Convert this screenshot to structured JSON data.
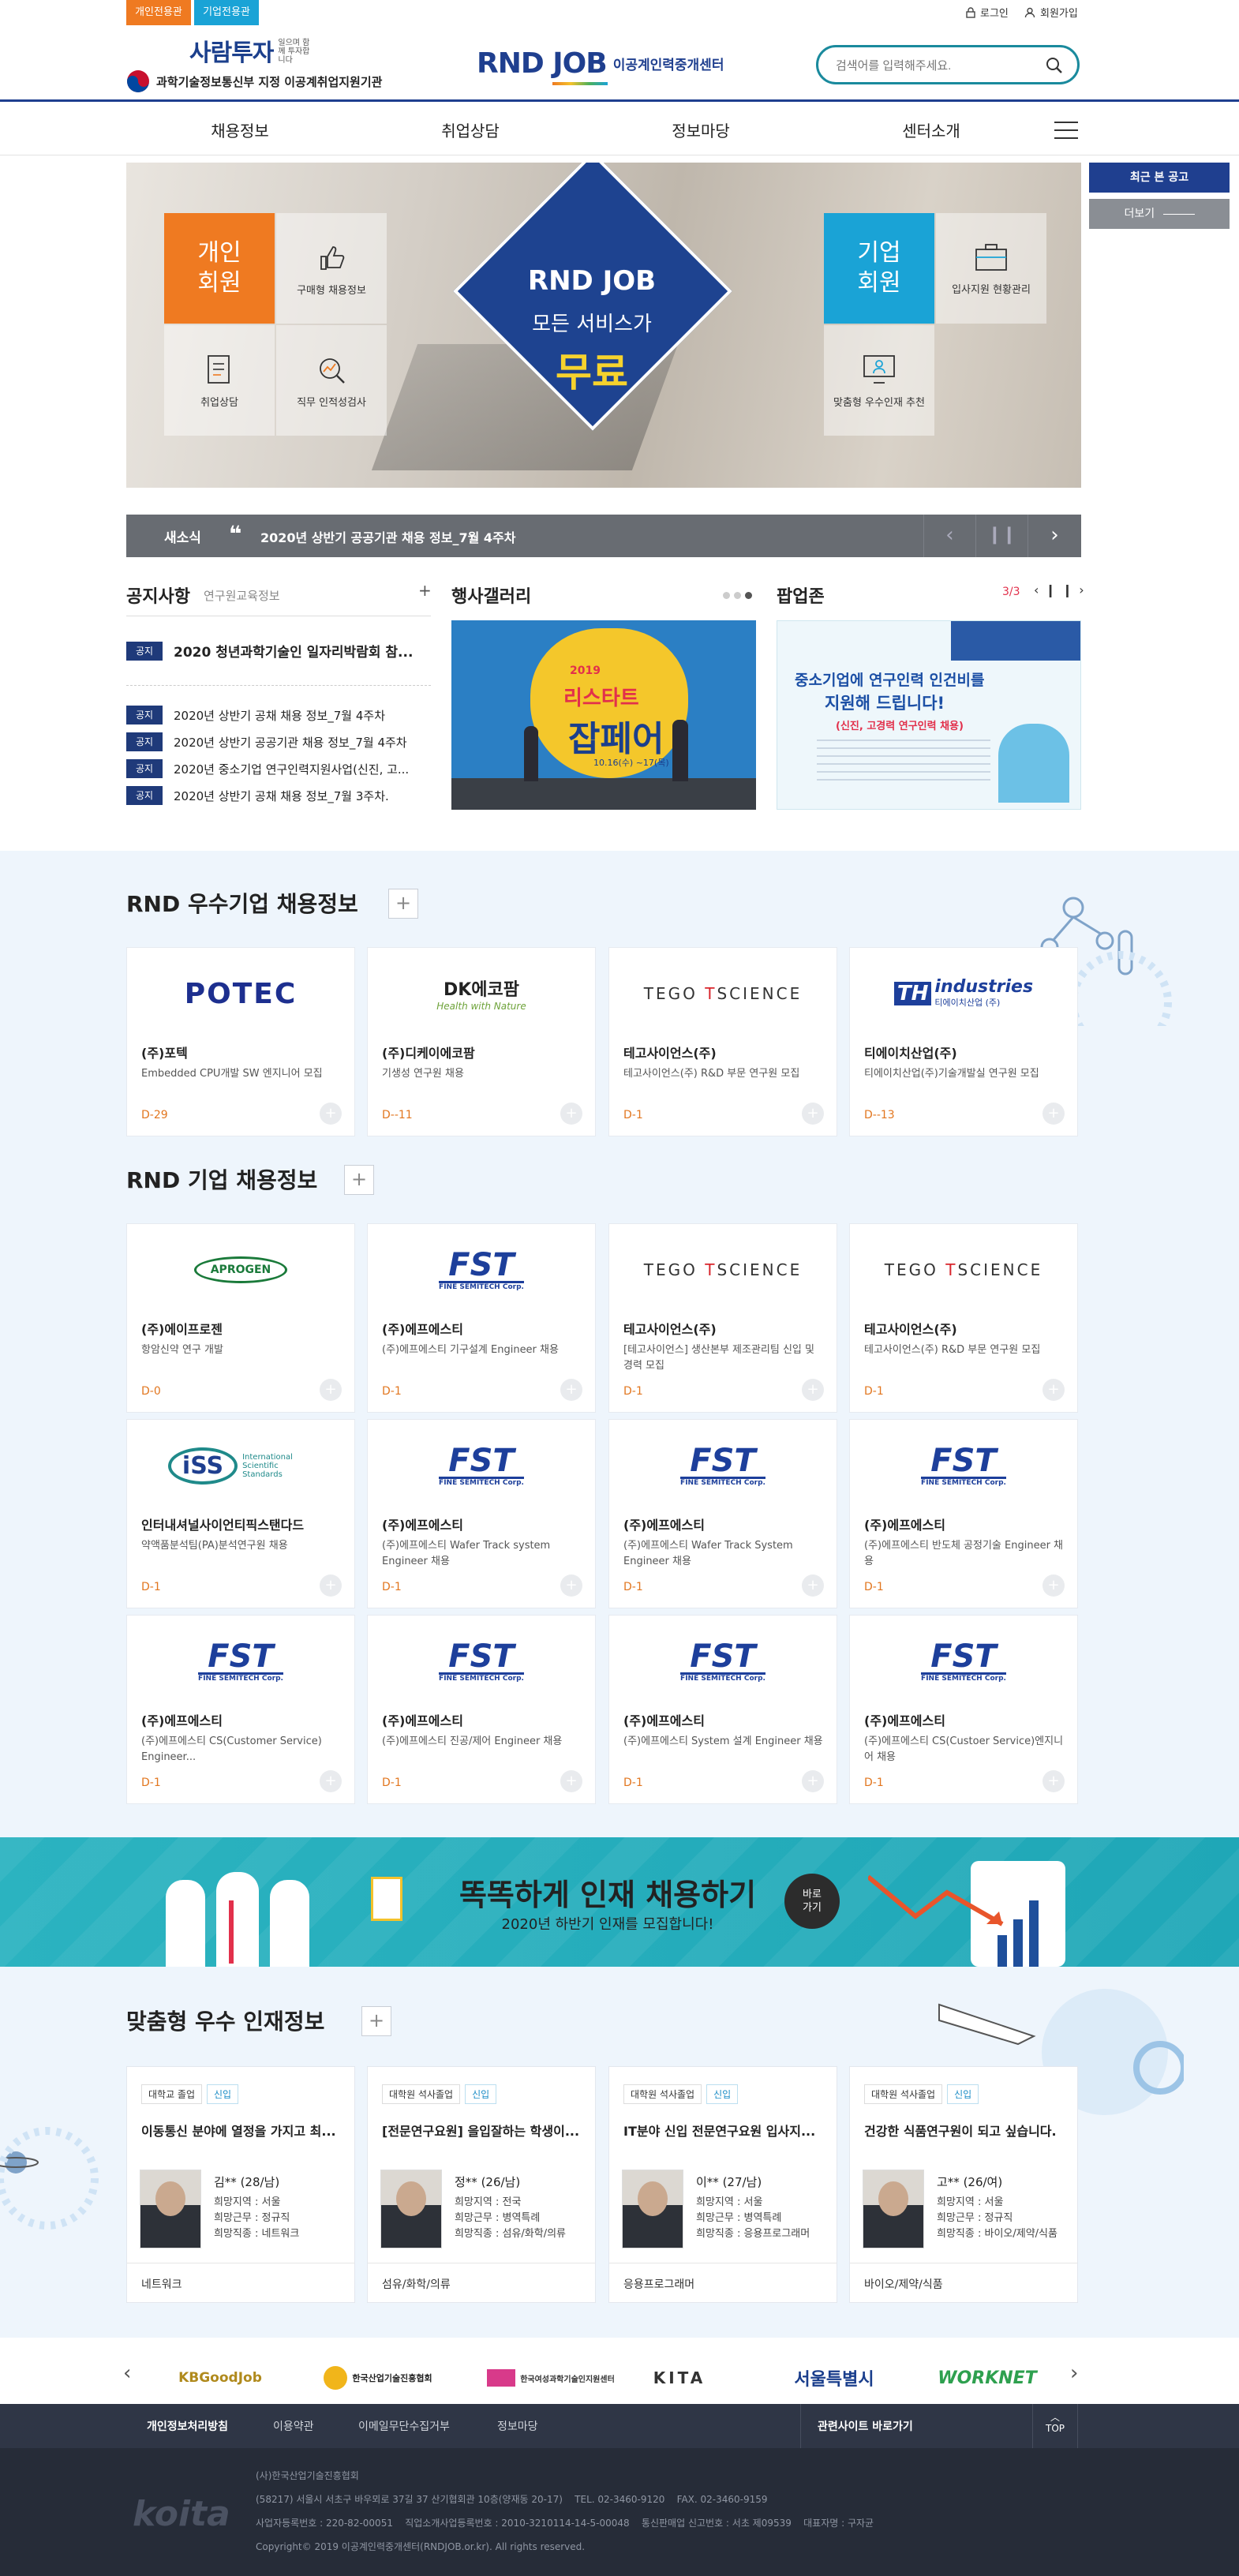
{
  "top": {
    "tabs": [
      "개인전용관",
      "기업전용관"
    ],
    "utils": {
      "login": "로그인",
      "join": "회원가입"
    },
    "brand_saramtuja": "사람투자",
    "brand_saramtuja_sub": "일으며 함께 투자합니다",
    "ministry": "과학기술정보통신부 지정 이공계취업지원기관",
    "logo_main": "RND JOB",
    "logo_sub": "이공계인력중개센터",
    "search_placeholder": "검색어를 입력해주세요."
  },
  "nav": [
    "채용정보",
    "취업상담",
    "정보마당",
    "센터소개"
  ],
  "side": {
    "recent": "최근 본 공고",
    "more": "더보기"
  },
  "hero": {
    "personal": "개인\n회원",
    "personal_items": [
      "구매형 채용정보",
      "취업상담",
      "직무 인적성검사"
    ],
    "center_logo": "RND JOB",
    "center_line1": "모든 서비스가",
    "center_line2": "무료",
    "corporate": "기업\n회원",
    "corporate_items": [
      "입사지원 현황관리",
      "맞춤형 우수인재 추천"
    ]
  },
  "news": {
    "label": "새소식",
    "text": "2020년 상반기 공공기관 채용 정보_7월 4주차"
  },
  "notice": {
    "title": "공지사항",
    "sub": "연구원교육정보",
    "badge": "공지",
    "headline": "2020 청년과학기술인 일자리박람회 참...",
    "items": [
      "2020년 상반기 공채 채용 정보_7월 4주차",
      "2020년 상반기 공공기관 채용 정보_7월 4주차",
      "2020년 중소기업 연구인력지원사업(신진, 고...",
      "2020년 상반기 공채 채용 정보_7월 3주차."
    ]
  },
  "gallery": {
    "title": "행사갤러리",
    "poster_year": "2019",
    "poster_title": "리스타트",
    "poster_title2": "잡페어",
    "poster_date": "10.16(수) ~17(목)"
  },
  "popup": {
    "title": "팝업존",
    "page": "3/3",
    "headline1": "중소기업에 연구인력 인건비를",
    "headline2": "지원해 드립니다!",
    "sub": "(신진, 고경력 연구인력 채용)"
  },
  "excellent": {
    "title": "RND 우수기업 채용정보",
    "cards": [
      {
        "logo": "POTEC",
        "name": "(주)포텍",
        "desc": "Embedded CPU개발 SW 엔지니어 모집",
        "dday": "D-29"
      },
      {
        "logo": "DK에코팜",
        "logo_sub": "Health with Nature",
        "name": "(주)디케이에코팜",
        "desc": "기생성 연구원 채용",
        "dday": "D--11"
      },
      {
        "logo": "TEGO SCIENCE",
        "name": "테고사이언스(주)",
        "desc": "테고사이언스(주) R&D 부문 연구원 모집",
        "dday": "D-1"
      },
      {
        "logo": "TH industries",
        "logo_sub": "티에이치산업 (주)",
        "name": "티에이치산업(주)",
        "desc": "티에이치산업(주)기술개발실 연구원 모집",
        "dday": "D--13"
      }
    ]
  },
  "jobs": {
    "title": "RND 기업 채용정보",
    "cards": [
      {
        "logo": "APROGEN",
        "name": "(주)에이프로젠",
        "desc": "항암신약 연구 개발",
        "dday": "D-0"
      },
      {
        "logo": "FST",
        "logo_sub": "FINE SEMITECH Corp.",
        "name": "(주)에프에스티",
        "desc": "(주)에프에스티 기구설계 Engineer 채용",
        "dday": "D-1"
      },
      {
        "logo": "TEGO SCIENCE",
        "name": "테고사이언스(주)",
        "desc": "[테고사이언스] 생산본부 제조관리팀 신입 및 경력 모집",
        "dday": "D-1"
      },
      {
        "logo": "TEGO SCIENCE",
        "name": "테고사이언스(주)",
        "desc": "테고사이언스(주) R&D 부문 연구원 모집",
        "dday": "D-1"
      },
      {
        "logo": "iSS",
        "logo_sub": "International Scientific Standards",
        "name": "인터내셔널사이언티픽스탠다드",
        "desc": "약액품분석팀(PA)분석연구원 채용",
        "dday": "D-1"
      },
      {
        "logo": "FST",
        "logo_sub": "FINE SEMITECH Corp.",
        "name": "(주)에프에스티",
        "desc": "(주)에프에스티 Wafer Track system Engineer 채용",
        "dday": "D-1"
      },
      {
        "logo": "FST",
        "logo_sub": "FINE SEMITECH Corp.",
        "name": "(주)에프에스티",
        "desc": "(주)에프에스티 Wafer Track System Engineer 채용",
        "dday": "D-1"
      },
      {
        "logo": "FST",
        "logo_sub": "FINE SEMITECH Corp.",
        "name": "(주)에프에스티",
        "desc": "(주)에프에스티 반도체 공정기술 Engineer 채용",
        "dday": "D-1"
      },
      {
        "logo": "FST",
        "logo_sub": "FINE SEMITECH Corp.",
        "name": "(주)에프에스티",
        "desc": "(주)에프에스티 CS(Customer Service) Engineer...",
        "dday": "D-1"
      },
      {
        "logo": "FST",
        "logo_sub": "FINE SEMITECH Corp.",
        "name": "(주)에프에스티",
        "desc": "(주)에프에스티 진공/제어 Engineer 채용",
        "dday": "D-1"
      },
      {
        "logo": "FST",
        "logo_sub": "FINE SEMITECH Corp.",
        "name": "(주)에프에스티",
        "desc": "(주)에프에스티 System 설계 Engineer 채용",
        "dday": "D-1"
      },
      {
        "logo": "FST",
        "logo_sub": "FINE SEMITECH Corp.",
        "name": "(주)에프에스티",
        "desc": "(주)에프에스티 CS(Custoer Service)엔지니어 채용",
        "dday": "D-1"
      }
    ]
  },
  "banner": {
    "title": "똑똑하게 인재 채용하기",
    "sub": "2020년 하반기 인재를 모집합니다!",
    "button": "바로\n가기"
  },
  "talent": {
    "title": "맞춤형 우수 인재정보",
    "cards": [
      {
        "edu": "대학교 졸업",
        "tag": "신입",
        "headline": "이동통신 분야에 열정을 가지고 최...",
        "name": "김** (28/남)",
        "area": "희망지역 : 서울",
        "type": "희망근무 : 정규직",
        "job": "희망직종 : 네트워크",
        "foot": "네트워크"
      },
      {
        "edu": "대학원 석사졸업",
        "tag": "신입",
        "headline": "[전문연구요원] 을입잘하는 학생이...",
        "name": "정** (26/남)",
        "area": "희망지역 : 전국",
        "type": "희망근무 : 병역특례",
        "job": "희망직종 : 섬유/화학/의류",
        "foot": "섬유/화학/의류"
      },
      {
        "edu": "대학원 석사졸업",
        "tag": "신입",
        "headline": "IT분야 신입 전문연구요원 입사지...",
        "name": "이** (27/남)",
        "area": "희망지역 : 서울",
        "type": "희망근무 : 병역특례",
        "job": "희망직종 : 응용프로그래머",
        "foot": "응용프로그래머"
      },
      {
        "edu": "대학원 석사졸업",
        "tag": "신입",
        "headline": "건강한 식품연구원이 되고 싶습니다.",
        "name": "고** (26/여)",
        "area": "희망지역 : 서울",
        "type": "희망근무 : 정규직",
        "job": "희망직종 : 바이오/제약/식품",
        "foot": "바이오/제약/식품"
      }
    ]
  },
  "partners": [
    "KBGoodJob",
    "한국산업기술진흥협회",
    "한국여성과학기술인지원센터",
    "KITA",
    "서울특별시",
    "WORKNET"
  ],
  "footer": {
    "links": [
      "개인정보처리방침",
      "이용약관",
      "이메일무단수집거부",
      "정보마당"
    ],
    "related": "관련사이트 바로가기",
    "top": "TOP",
    "logo": "koita",
    "org": "(사)한국산업기술진흥협회",
    "addr": "(58217) 서울시 서초구 바우뫼로 37길 37 산기협회관 10층(양재동 20-17)    TEL. 02-3460-9120    FAX. 02-3460-9159",
    "biz": "사업자등록번호 : 220-82-00051    직업소개사업등록번호 : 2010-3210114-14-5-00048    통신판매업 신고번호 : 서초 제09539    대표자명 : 구자균",
    "copy": "Copyright© 2019 이공계인력중개센터(RNDJOB.or.kr). All rights reserved."
  }
}
